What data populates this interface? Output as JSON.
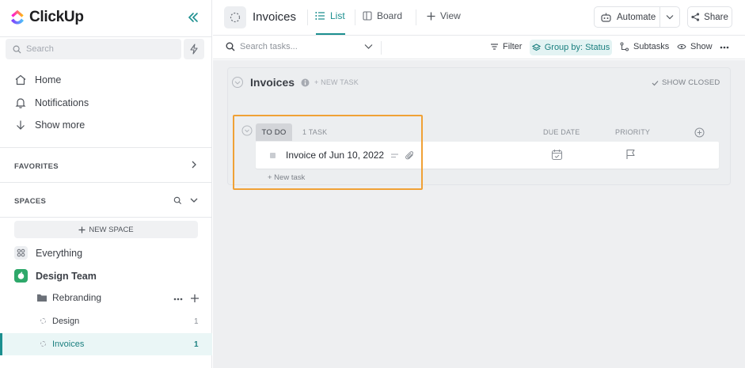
{
  "sidebar": {
    "brand": "ClickUp",
    "search_placeholder": "Search",
    "nav": [
      {
        "label": "Home",
        "icon": "home-icon"
      },
      {
        "label": "Notifications",
        "icon": "bell-icon"
      },
      {
        "label": "Show more",
        "icon": "arrow-down-icon"
      }
    ],
    "favorites_label": "FAVORITES",
    "spaces_label": "SPACES",
    "new_space_label": "NEW SPACE",
    "everything_label": "Everything",
    "space_name": "Design Team",
    "folder_name": "Rebranding",
    "lists": [
      {
        "label": "Design",
        "count": "1",
        "active": false
      },
      {
        "label": "Invoices",
        "count": "1",
        "active": true
      }
    ]
  },
  "header": {
    "title": "Invoices",
    "tabs": [
      {
        "label": "List",
        "active": true
      },
      {
        "label": "Board",
        "active": false
      }
    ],
    "add_view_label": "View",
    "automate_label": "Automate",
    "share_label": "Share"
  },
  "toolbar": {
    "search_placeholder": "Search tasks...",
    "filter_label": "Filter",
    "group_by_label": "Group by: Status",
    "subtasks_label": "Subtasks",
    "show_label": "Show"
  },
  "list": {
    "title": "Invoices",
    "new_task_label": "+ NEW TASK",
    "show_closed_label": "SHOW CLOSED",
    "group": {
      "status": "TO DO",
      "task_count": "1 TASK",
      "columns": [
        "DUE DATE",
        "PRIORITY"
      ],
      "tasks": [
        {
          "name": "Invoice of Jun 10, 2022"
        }
      ],
      "new_task_row": "+ New task"
    }
  },
  "colors": {
    "accent": "#1c8f8f",
    "highlight": "#f0a136",
    "space_icon": "#2ea86a"
  }
}
